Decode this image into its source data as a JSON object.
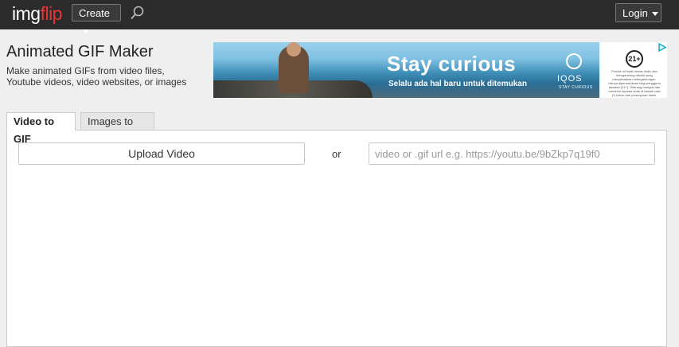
{
  "header": {
    "logo_part1": "img",
    "logo_part2": "flip",
    "create_label": "Create",
    "login_label": "Login"
  },
  "page": {
    "title": "Animated GIF Maker",
    "subtitle": "Make animated GIFs from video files, Youtube videos, video websites, or images"
  },
  "ad": {
    "headline": "Stay curious",
    "tagline": "Selalu ada hal baru untuk ditemukan",
    "brand": "IQOS",
    "brand_sub": "STAY CURIOUS",
    "age_badge": "21+",
    "warning": "Produk ini tidak bebas risiko dan mengandung nikotin yang menyebabkan ketergantungan. Hanya diperuntukkan bagi pengguna dewasa (21+). Dilarang menjual dan memberi kepada anak di bawah usia 21 tahun dan perempuan hamil."
  },
  "tabs": [
    {
      "label": "Video to GIF",
      "active": true
    },
    {
      "label": "Images to GIF",
      "active": false
    }
  ],
  "upload": {
    "button_label": "Upload Video",
    "or_label": "or",
    "url_placeholder": "video or .gif url e.g. https://youtu.be/9bZkp7q19f0",
    "url_value": ""
  },
  "colors": {
    "topbar_bg": "#2b2b2b",
    "logo_accent": "#e83535",
    "page_bg": "#efefef"
  }
}
